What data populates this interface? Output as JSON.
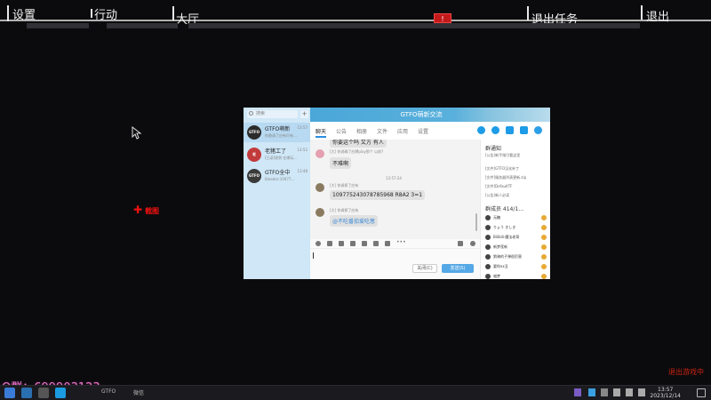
{
  "game_menu": {
    "settings": "设置",
    "action": "行动",
    "lobby": "大厅",
    "alert_badge": "!",
    "quit_mission": "退出任务",
    "quit": "退出"
  },
  "overlay": {
    "red_label": "截图",
    "qq_group": "Q群：699903123",
    "corner_label": "退出游戏中"
  },
  "qq": {
    "window_title": "GTFO萌新交流",
    "search_placeholder": "搜索",
    "conversations": [
      {
        "name": "GTFO萌新",
        "time": "13:57",
        "preview": "你邀请了应有尽有…",
        "avatar": "GTFO"
      },
      {
        "name": "老猪工了",
        "time": "13:52",
        "preview": "[已读]收到 在哪玩…",
        "avatar": "老"
      },
      {
        "name": "GTFO全中",
        "time": "13:48",
        "preview": "Bleeder:10977…",
        "avatar": "GTFO"
      }
    ],
    "tabs": [
      "聊天",
      "公告",
      "相册",
      "文件",
      "应用",
      "设置"
    ],
    "messages": {
      "m1_bubble": "你要这个吗 又方 有人",
      "m2_meta": "[大] 你说确了应聘play那个 以前?",
      "m2_bubble": "不难啊",
      "timestamp": "13:57:24",
      "m3_meta": "[大] 你调探了应有",
      "m3_bubble": "10977524307878596​8 R8A2 3=1",
      "m4_meta": "[大] 你调探了应有",
      "m4_bubble": "@不吃番茄爱吃葱"
    },
    "buttons": {
      "close": "关闭(C)",
      "send": "发送(S)"
    },
    "notice": {
      "title": "群通知",
      "items": [
        "[公告]新手指引看这里",
        "[文件]GTFO汉化补丁",
        "[文件]服务器列表更新.zip",
        "[文件]DefaultTF",
        "[公告]新人必读"
      ]
    },
    "members": {
      "title": "群成员 414/1…",
      "list": [
        "无糖",
        "りょう きしき",
        "Bilibili-魔法老哥",
        "新梦莲新",
        "狼骑的子弹很厉害",
        "要你xx丑",
        "喵梦",
        "G爵鉴号"
      ]
    }
  },
  "taskbar": {
    "time": "13:57",
    "date": "2023/12/14",
    "item1": "GTFO",
    "item2": "微信"
  }
}
